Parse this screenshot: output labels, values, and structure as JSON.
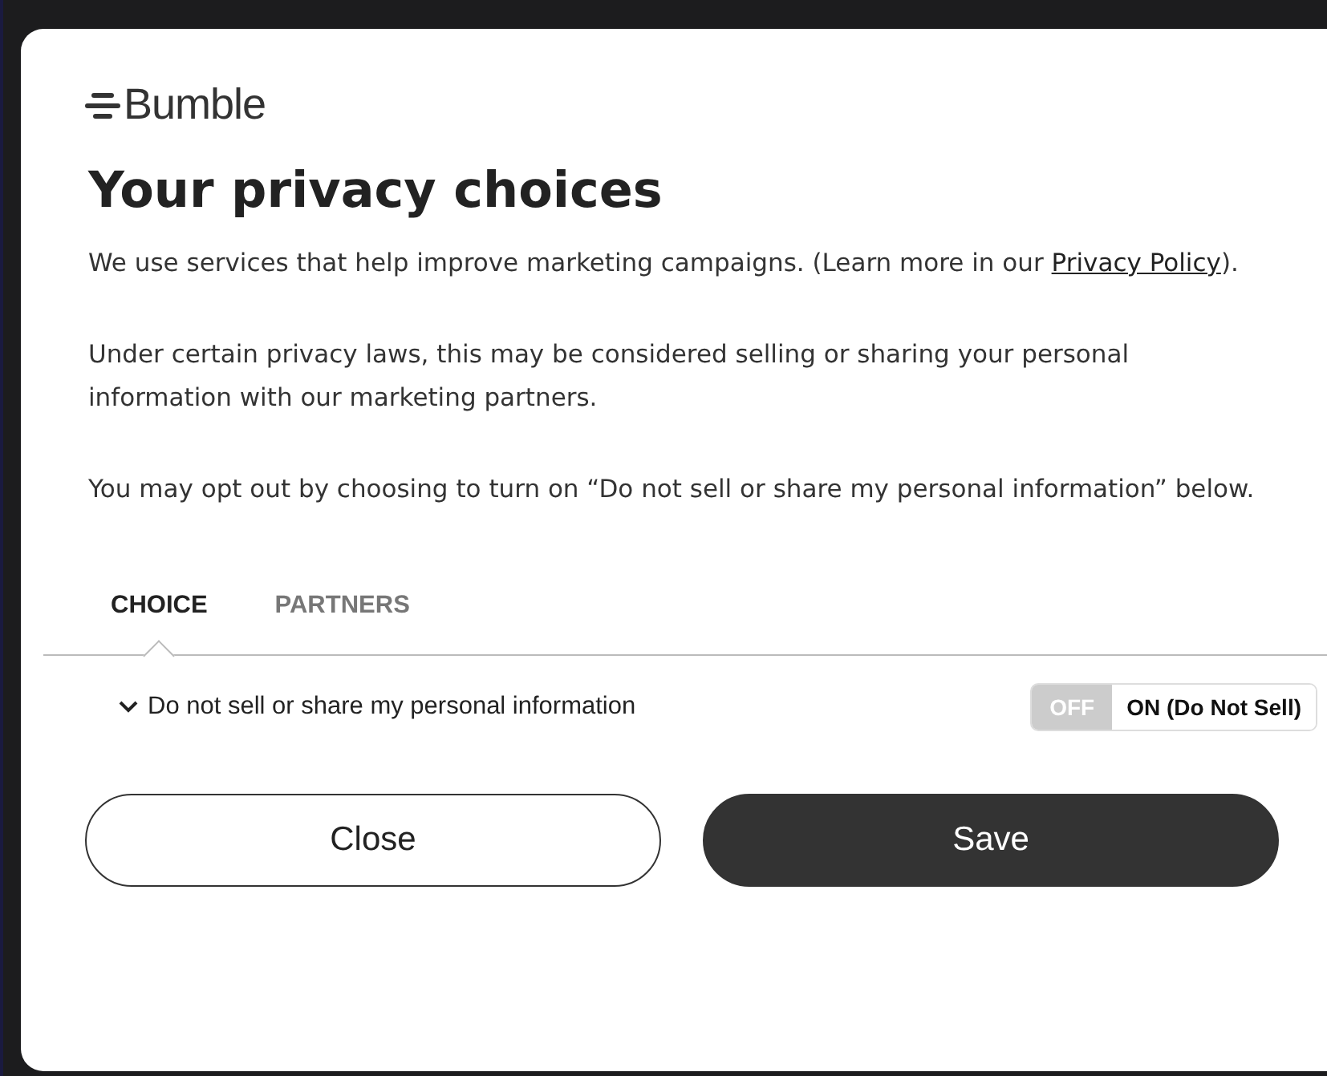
{
  "logo": {
    "text": "Bumble"
  },
  "title": "Your privacy choices",
  "paragraphs": [
    {
      "text": "We use services that help improve marketing campaigns. (Learn more in our ",
      "link": "Privacy Policy",
      "after": ")."
    },
    {
      "text": "Under certain privacy laws, this may be considered selling or sharing your personal information with our marketing partners."
    },
    {
      "text": "You may opt out by choosing to turn on “Do not sell or share my personal information” below."
    }
  ],
  "tabs": [
    {
      "label": "CHOICE",
      "selected": true
    },
    {
      "label": "PARTNERS",
      "selected": false
    }
  ],
  "setting": {
    "label": "Do not sell or share my personal information",
    "expanded": false,
    "options": [
      {
        "label": "OFF",
        "selected": false
      },
      {
        "label": "ON (Do Not Sell)",
        "selected": true
      }
    ]
  },
  "buttons": [
    {
      "label": "Close",
      "kind": "secondary"
    },
    {
      "label": "Save",
      "kind": "primary"
    }
  ]
}
